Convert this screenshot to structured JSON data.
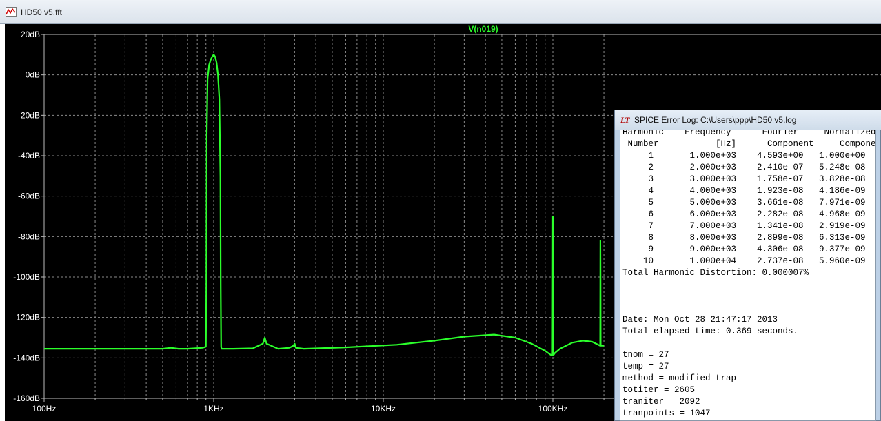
{
  "plot_window": {
    "title": "HD50 v5.fft"
  },
  "chart_data": {
    "type": "line",
    "title": "V(n019)",
    "x_scale": "log",
    "y_scale": "linear",
    "xlim": [
      100,
      200000
    ],
    "ylim": [
      -160,
      20
    ],
    "grid": true,
    "background": "#000000",
    "trace_color": "#2bff2b",
    "y_ticks": [
      20,
      0,
      -20,
      -40,
      -60,
      -80,
      -100,
      -120,
      -140,
      -160
    ],
    "y_tick_labels": [
      "20dB",
      "0dB",
      "-20dB",
      "-40dB",
      "-60dB",
      "-80dB",
      "-100dB",
      "-120dB",
      "-140dB",
      "-160dB"
    ],
    "x_ticks": [
      100,
      1000,
      10000,
      100000
    ],
    "x_tick_labels": [
      "100Hz",
      "1KHz",
      "10KHz",
      "100KHz"
    ],
    "series": [
      {
        "name": "V(n019)",
        "x": [
          100,
          500,
          560,
          620,
          700,
          860,
          900,
          905,
          910,
          920,
          940,
          960,
          980,
          1000,
          1020,
          1040,
          1060,
          1080,
          1095,
          1100,
          1106,
          1112,
          1300,
          1700,
          1950,
          2000,
          2050,
          2400,
          2800,
          2950,
          3000,
          3050,
          3400,
          6000,
          12000,
          20000,
          30000,
          45000,
          60000,
          75000,
          90000,
          97000,
          99500,
          99800,
          100000,
          100200,
          100500,
          101000,
          103000,
          110000,
          130000,
          150000,
          170000,
          185000,
          190000,
          190500,
          191000,
          191500,
          192000,
          200000
        ],
        "y": [
          -135.5,
          -135.5,
          -135.0,
          -135.5,
          -135.5,
          -135.0,
          -134.5,
          -105,
          -30,
          -2,
          5,
          7.5,
          9,
          10,
          9,
          6,
          0,
          -12,
          -50,
          -104,
          -134.5,
          -135.5,
          -135.5,
          -135.3,
          -133,
          -130,
          -133,
          -135.5,
          -135,
          -134,
          -133,
          -135,
          -135.5,
          -134.8,
          -133.5,
          -131.5,
          -129.5,
          -128.5,
          -130,
          -133,
          -136.5,
          -138.5,
          -138.5,
          -100,
          -70,
          -100,
          -138.5,
          -138.5,
          -137.5,
          -135.5,
          -132.5,
          -131.5,
          -132,
          -133.5,
          -134,
          -82,
          -95,
          -134,
          -134,
          -134
        ]
      }
    ]
  },
  "log_window": {
    "title": "SPICE Error Log: C:\\Users\\ppp\\HD50 v5.log",
    "headers": [
      [
        "Harmonic",
        "Frequency",
        "Fourier",
        "Normalized"
      ],
      [
        "Number",
        "[Hz]",
        "Component",
        "Component"
      ]
    ],
    "harmonics": [
      [
        "1",
        "1.000e+03",
        "4.593e+00",
        "1.000e+00"
      ],
      [
        "2",
        "2.000e+03",
        "2.410e-07",
        "5.248e-08"
      ],
      [
        "3",
        "3.000e+03",
        "1.758e-07",
        "3.828e-08"
      ],
      [
        "4",
        "4.000e+03",
        "1.923e-08",
        "4.186e-09"
      ],
      [
        "5",
        "5.000e+03",
        "3.661e-08",
        "7.971e-09"
      ],
      [
        "6",
        "6.000e+03",
        "2.282e-08",
        "4.968e-09"
      ],
      [
        "7",
        "7.000e+03",
        "1.341e-08",
        "2.919e-09"
      ],
      [
        "8",
        "8.000e+03",
        "2.899e-08",
        "6.313e-09"
      ],
      [
        "9",
        "9.000e+03",
        "4.306e-08",
        "9.377e-09"
      ],
      [
        "10",
        "1.000e+04",
        "2.737e-08",
        "5.960e-09"
      ]
    ],
    "thd": "Total Harmonic Distortion: 0.000007%",
    "date": "Date: Mon Oct 28 21:47:17 2013",
    "elapsed": "Total elapsed time: 0.369 seconds.",
    "params": [
      "tnom = 27",
      "temp = 27",
      "method = modified trap",
      "totiter = 2605",
      "traniter = 2092",
      "tranpoints = 1047"
    ]
  }
}
